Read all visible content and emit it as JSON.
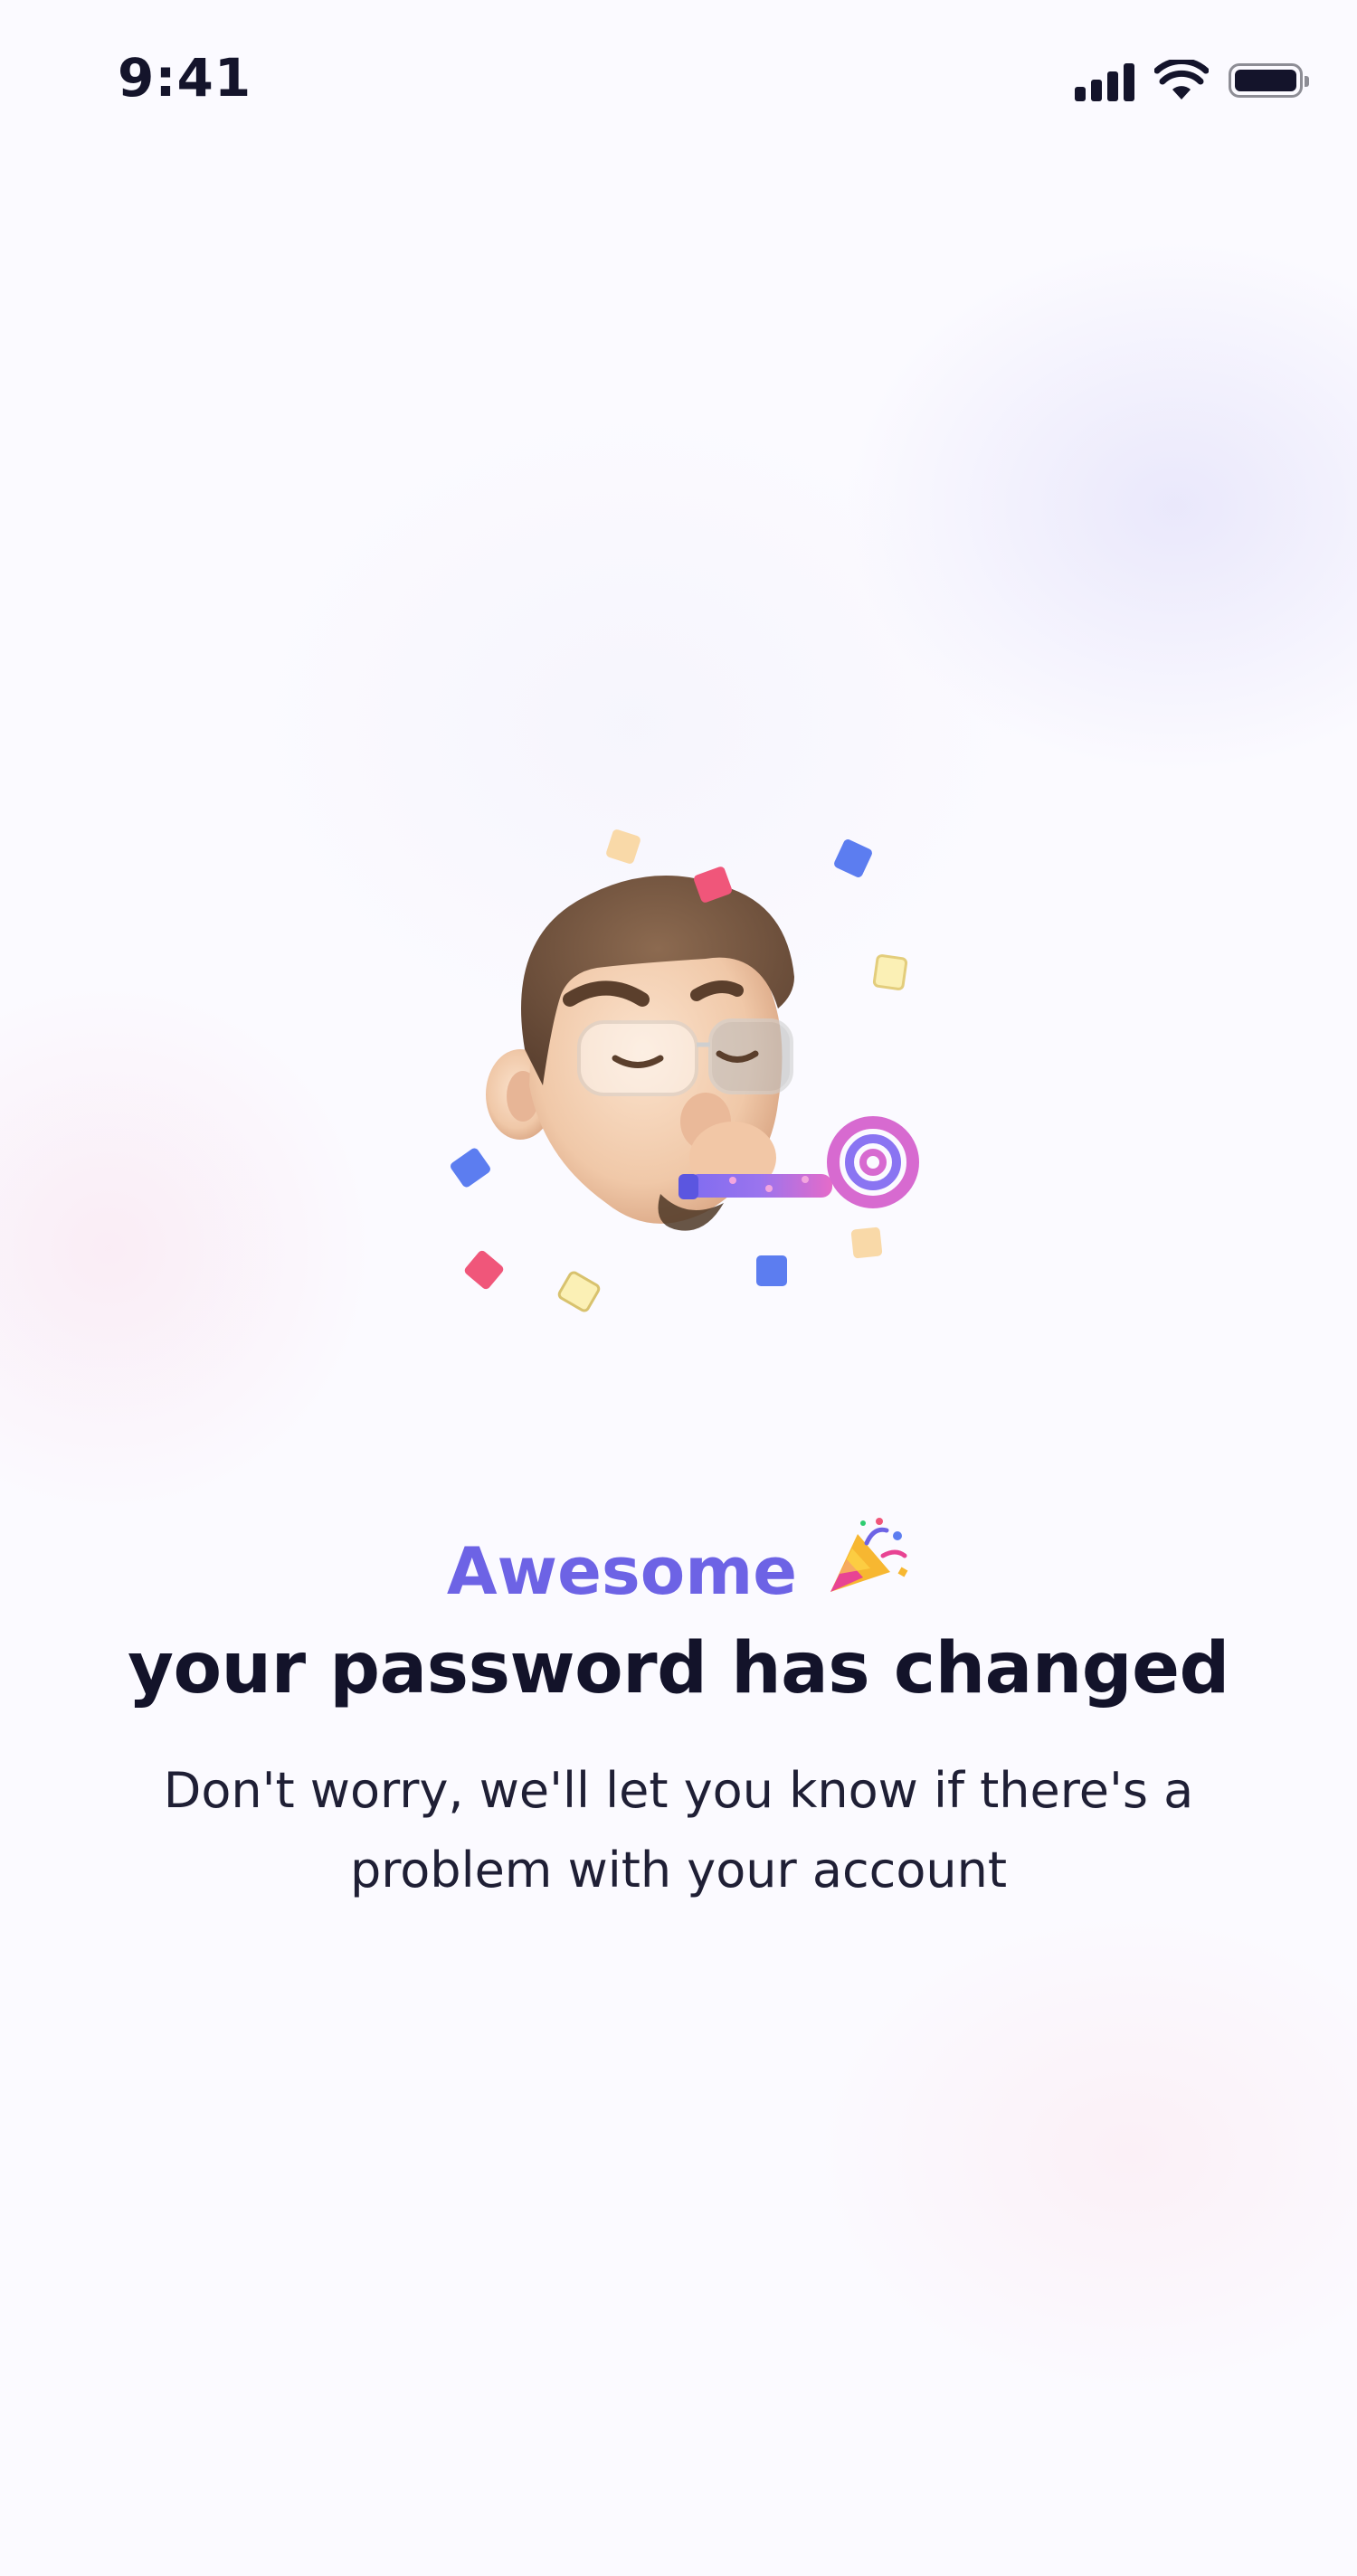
{
  "status_bar": {
    "time": "9:41",
    "icons": [
      "signal-icon",
      "wifi-icon",
      "battery-icon"
    ]
  },
  "illustration": {
    "name": "party-memoji-illustration"
  },
  "message": {
    "headline": "Awesome",
    "headline_icon": "party-popper-icon",
    "title": "your password has changed",
    "body": "Don't worry, we'll let you know if there's a problem with your account"
  },
  "colors": {
    "accent": "#6d63e5",
    "text_primary": "#13132a",
    "text_secondary": "#1f1f35"
  }
}
